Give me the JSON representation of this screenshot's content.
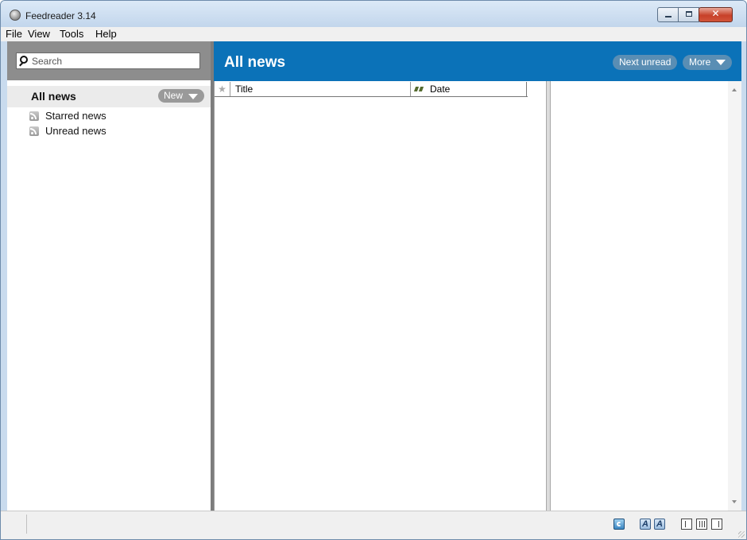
{
  "window": {
    "title": "Feedreader 3.14"
  },
  "menu": [
    "File",
    "View",
    "Tools",
    "Help"
  ],
  "search": {
    "placeholder": "Search"
  },
  "sidebar": {
    "all_news_label": "All news",
    "new_button_label": "New",
    "feeds": [
      {
        "label": "Starred news",
        "icon": "rss-icon"
      },
      {
        "label": "Unread news",
        "icon": "rss-icon"
      }
    ]
  },
  "main": {
    "header_title": "All news",
    "next_unread_label": "Next unread",
    "more_label": "More",
    "columns": {
      "star": "★",
      "title": "Title",
      "date": "Date"
    }
  },
  "statusbar": {
    "font_icon_glyph_1": "A",
    "font_icon_glyph_2": "A"
  },
  "colors": {
    "header_blue": "#0b72b8",
    "sidebar_search_bg": "#8d8d8d",
    "pill_gray": "#9a9a9a",
    "pill_blue": "#5a8eb4"
  }
}
